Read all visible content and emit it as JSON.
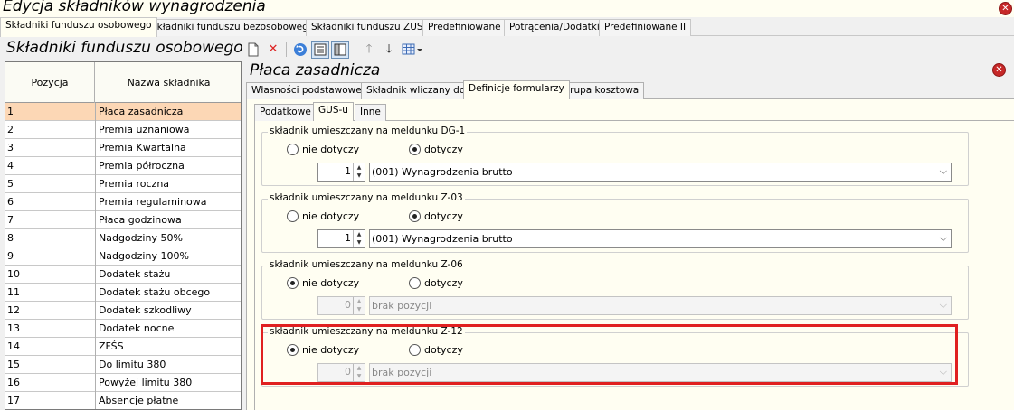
{
  "window": {
    "title": "Edycja składników wynagrodzenia"
  },
  "top_tabs": [
    {
      "label": "Składniki funduszu osobowego",
      "active": true
    },
    {
      "label": "Składniki funduszu bezosobowego",
      "active": false
    },
    {
      "label": "Składniki funduszu ZUS",
      "active": false
    },
    {
      "label": "Predefiniowane I",
      "active": false
    },
    {
      "label": "Potrącenia/Dodatki",
      "active": false
    },
    {
      "label": "Predefiniowane II",
      "active": false
    }
  ],
  "left_panel": {
    "title": "Składniki funduszu osobowego",
    "columns": [
      "Pozycja",
      "Nazwa składnika"
    ],
    "rows": [
      [
        "1",
        "Płaca zasadnicza"
      ],
      [
        "2",
        "Premia uznaniowa"
      ],
      [
        "3",
        "Premia Kwartalna"
      ],
      [
        "4",
        "Premia półroczna"
      ],
      [
        "5",
        "Premia roczna"
      ],
      [
        "6",
        "Premia regulaminowa"
      ],
      [
        "7",
        "Płaca godzinowa"
      ],
      [
        "8",
        "Nadgodziny 50%"
      ],
      [
        "9",
        "Nadgodziny 100%"
      ],
      [
        "10",
        "Dodatek stażu"
      ],
      [
        "11",
        "Dodatek stażu obcego"
      ],
      [
        "12",
        "Dodatek szkodliwy"
      ],
      [
        "13",
        "Dodatek nocne"
      ],
      [
        "14",
        "ZFŚS"
      ],
      [
        "15",
        "Do limitu 380"
      ],
      [
        "16",
        "Powyżej limitu 380"
      ],
      [
        "17",
        "Absencje płatne"
      ]
    ],
    "selected_row": 0
  },
  "toolbar": {
    "icons": [
      "new-document-icon",
      "delete-icon",
      "refresh-icon",
      "view-form-icon",
      "split-view-icon",
      "move-up-icon",
      "move-down-icon",
      "grid-options-icon"
    ]
  },
  "detail": {
    "title": "Płaca zasadnicza",
    "tabs": [
      {
        "label": "Własności podstawowe",
        "active": false
      },
      {
        "label": "Składnik wliczany do",
        "active": false
      },
      {
        "label": "Definicje formularzy",
        "active": true
      },
      {
        "label": "Grupa kosztowa",
        "active": false
      }
    ],
    "subtabs": [
      {
        "label": "Podatkowe",
        "active": false
      },
      {
        "label": "GUS-u",
        "active": true
      },
      {
        "label": "Inne",
        "active": false
      }
    ],
    "option_no": "nie dotyczy",
    "option_yes": "dotyczy",
    "groups": [
      {
        "title": "składnik umieszczany na meldunku DG-1",
        "selected": "yes",
        "spinner": "1",
        "combo": "(001) Wynagrodzenia brutto",
        "disabled": false
      },
      {
        "title": "składnik umieszczany na meldunku Z-03",
        "selected": "yes",
        "spinner": "1",
        "combo": "(001) Wynagrodzenia brutto",
        "disabled": false
      },
      {
        "title": "składnik umieszczany na meldunku Z-06",
        "selected": "no",
        "spinner": "0",
        "combo": "brak pozycji",
        "disabled": true
      },
      {
        "title": "składnik umieszczany na meldunku Z-12",
        "selected": "no",
        "spinner": "0",
        "combo": "brak pozycji",
        "disabled": true
      }
    ]
  },
  "colors": {
    "accent_highlight": "#e02020",
    "selected_row": "#fcd7b5",
    "panel_background": "#fffef2",
    "close_button": "#c62828"
  }
}
